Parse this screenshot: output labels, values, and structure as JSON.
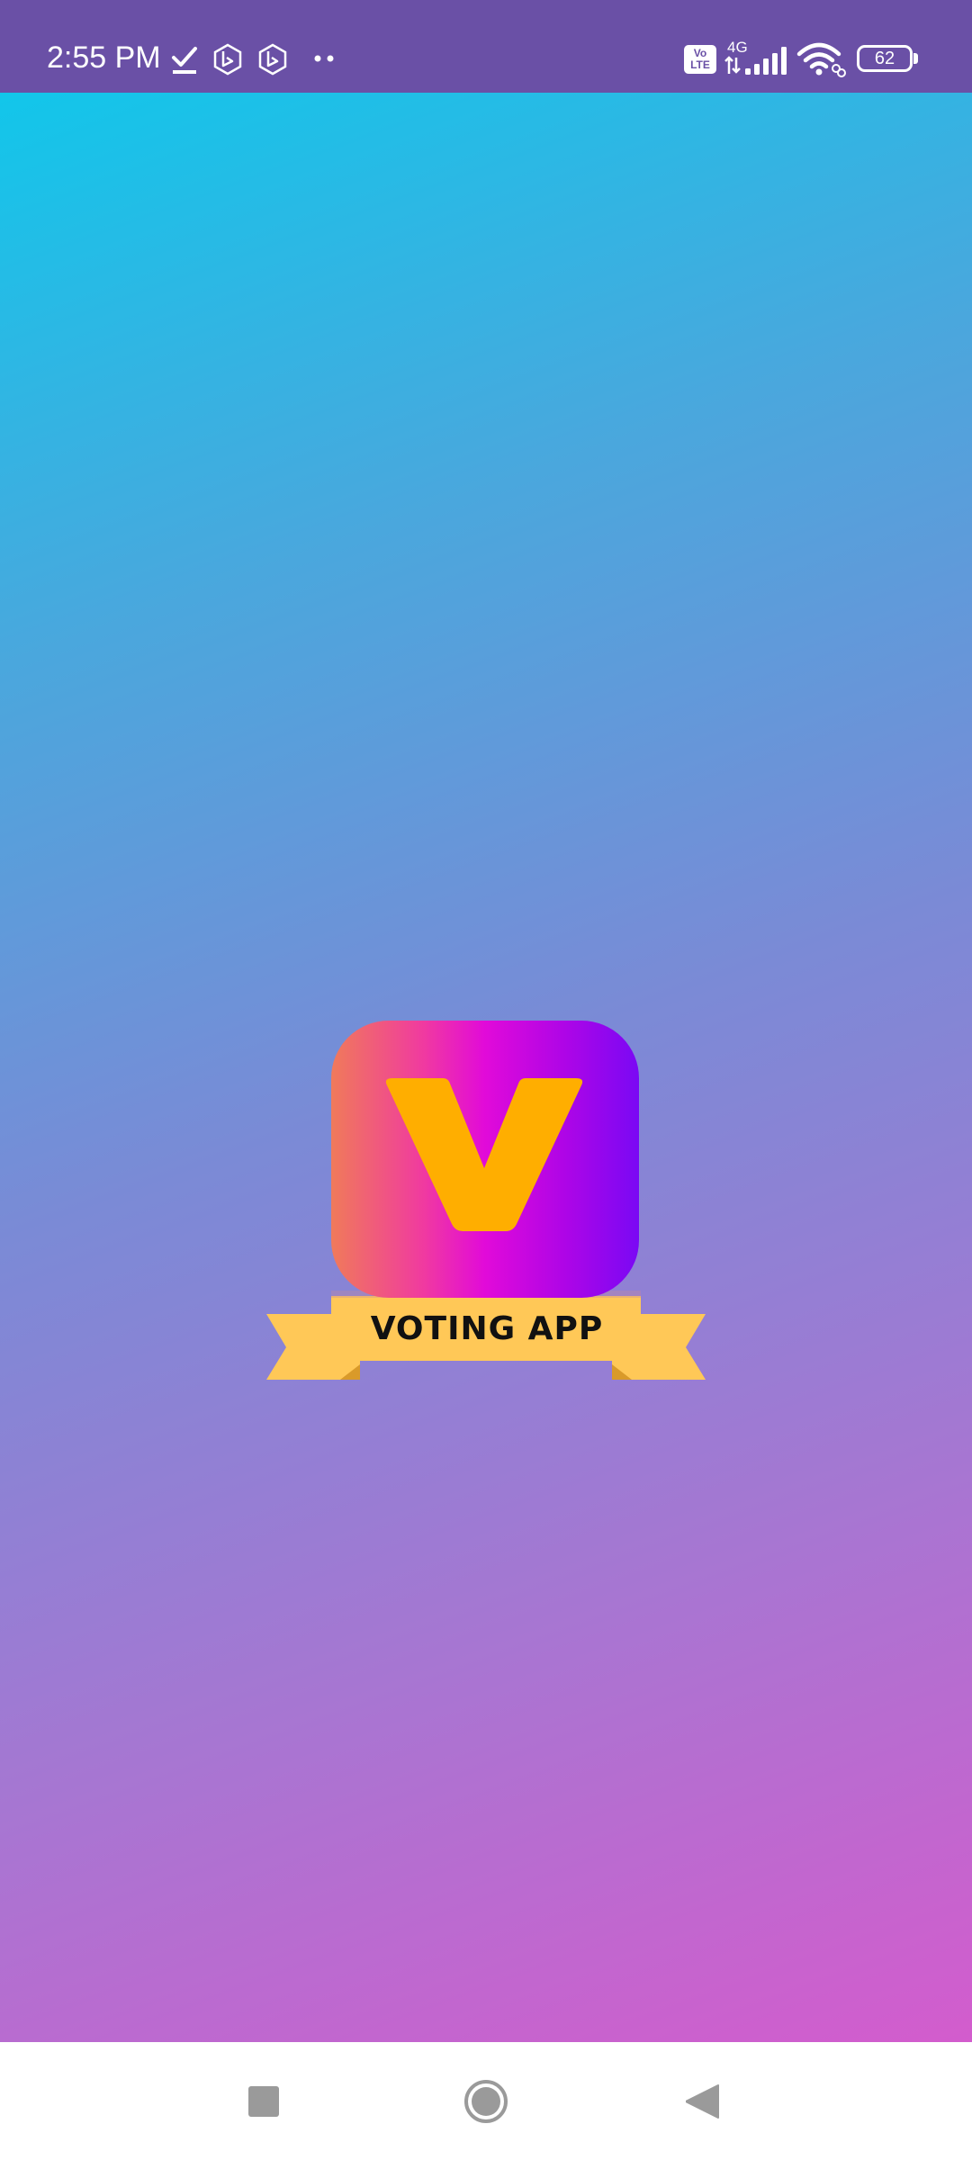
{
  "status_bar": {
    "time": "2:55 PM",
    "icons": [
      "check-download-icon",
      "bing-icon",
      "bing-icon",
      "more-dots-icon",
      "volte-icon",
      "signal-icon",
      "wifi-icon",
      "battery-icon"
    ],
    "volte_line1": "Vo",
    "volte_line2": "LTE",
    "network_type": "4G",
    "battery_level": "62",
    "background_color": "#6a50a6"
  },
  "splash": {
    "logo_letter": "V",
    "app_name": "VOTING APP",
    "gradient_colors": [
      "#12c6ea",
      "#7b8ad6",
      "#d35ccd"
    ],
    "tile_gradient": [
      "#f07a5a",
      "#e10ad9",
      "#7a08f4"
    ],
    "accent_yellow": "#ffc857",
    "letter_color": "#ffae00"
  },
  "nav_bar": {
    "buttons": [
      "recents-square-icon",
      "home-circle-icon",
      "back-triangle-icon"
    ]
  }
}
